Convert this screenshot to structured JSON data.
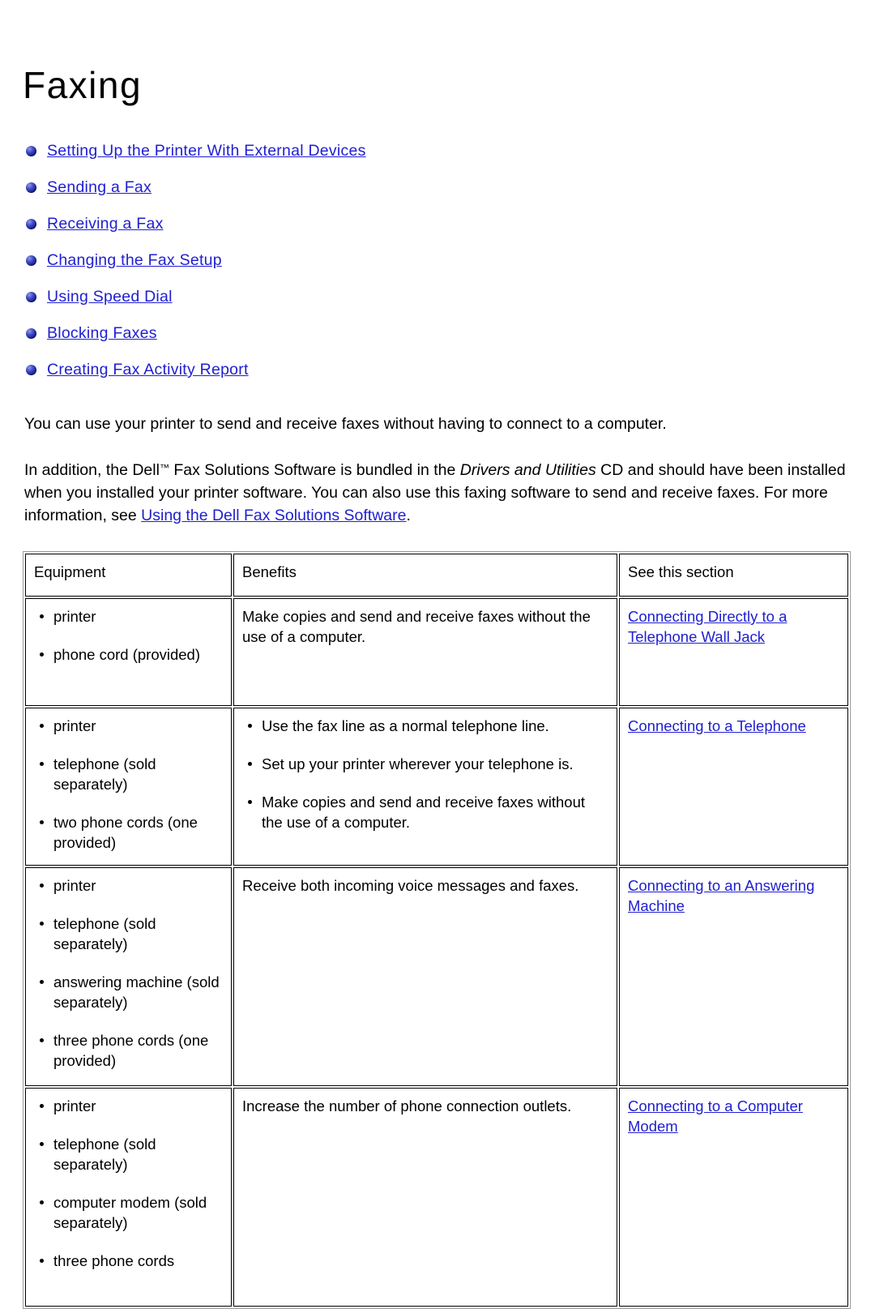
{
  "document": {
    "title": "Faxing"
  },
  "toc": {
    "bullet_icon": "blue-sphere-bullet-icon",
    "items": [
      {
        "label": "Setting Up the Printer With External Devices"
      },
      {
        "label": "Sending a Fax"
      },
      {
        "label": "Receiving a Fax"
      },
      {
        "label": "Changing the Fax Setup"
      },
      {
        "label": "Using Speed Dial"
      },
      {
        "label": "Blocking Faxes"
      },
      {
        "label": "Creating Fax Activity Report"
      }
    ]
  },
  "paragraphs": {
    "p1": "You can use your printer to send and receive faxes without having to connect to a computer.",
    "p2_part1": "In addition, the Dell",
    "p2_tm": "™",
    "p2_part2": " Fax Solutions Software is bundled in the ",
    "p2_italic": "Drivers and Utilities",
    "p2_part3": " CD and should have been installed when you installed your printer software. You can also use this faxing software to send and receive faxes. For more information, see ",
    "p2_link": "Using the Dell Fax Solutions Software",
    "p2_part4": "."
  },
  "table": {
    "headers": {
      "equipment": "Equipment",
      "benefits": "Benefits",
      "section": "See this section"
    },
    "rows": [
      {
        "equipment": [
          "printer",
          "phone cord (provided)"
        ],
        "benefits_type": "plain",
        "benefits_text": "Make copies and send and receive faxes without the use of a computer.",
        "benefits": [],
        "link": "Connecting Directly to a Telephone Wall Jack"
      },
      {
        "equipment": [
          "printer",
          "telephone (sold separately)",
          "two phone cords (one provided)"
        ],
        "benefits_type": "list",
        "benefits_text": "",
        "benefits": [
          "Use the fax line as a normal telephone line.",
          "Set up your printer wherever your telephone is.",
          "Make copies and send and receive faxes without the use of a computer."
        ],
        "link": "Connecting to a Telephone"
      },
      {
        "equipment": [
          "printer",
          "telephone (sold separately)",
          "answering machine (sold separately)",
          "three phone cords (one provided)"
        ],
        "benefits_type": "plain",
        "benefits_text": "Receive both incoming voice messages and faxes.",
        "benefits": [],
        "link": "Connecting to an Answering Machine"
      },
      {
        "equipment": [
          "printer",
          "telephone (sold separately)",
          "computer modem (sold separately)",
          "three phone cords"
        ],
        "benefits_type": "plain",
        "benefits_text": "Increase the number of phone connection outlets.",
        "benefits": [],
        "link": "Connecting to a Computer Modem"
      }
    ]
  },
  "colors": {
    "link": "#2020d0",
    "text": "#000000",
    "background": "#ffffff",
    "table_border": "#000000",
    "table_outer_border": "#9a9a9a"
  }
}
